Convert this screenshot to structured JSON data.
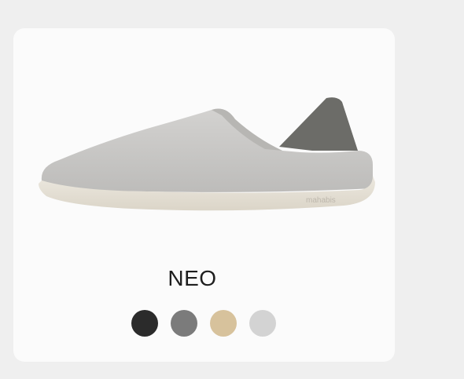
{
  "product": {
    "name": "NEO",
    "brand_mark": "mahabis"
  },
  "swatches": [
    {
      "name": "black",
      "color": "#2b2b2b"
    },
    {
      "name": "grey",
      "color": "#7b7b7b"
    },
    {
      "name": "sand",
      "color": "#d7c29c"
    },
    {
      "name": "light-grey",
      "color": "#d3d3d3"
    }
  ],
  "colors": {
    "background": "#efefef",
    "card": "#fbfbfb",
    "shoe_upper": "#c9c9c9",
    "shoe_sole": "#e4dfd4",
    "shoe_heel": "#6e6e6a"
  }
}
